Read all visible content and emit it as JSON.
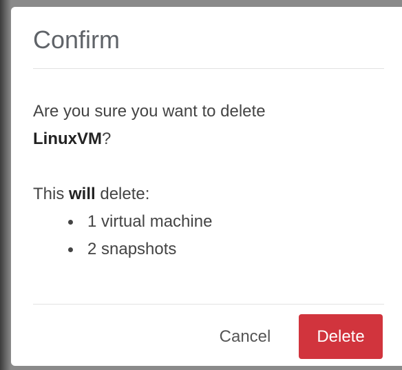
{
  "dialog": {
    "title": "Confirm",
    "question_prefix": "Are you sure you want to delete",
    "target_name": "LinuxVM",
    "question_suffix": "?",
    "will_prefix": "This ",
    "will_emphasis": "will",
    "will_suffix": " delete:",
    "items": [
      "1 virtual machine",
      "2 snapshots"
    ],
    "cancel_label": "Cancel",
    "delete_label": "Delete"
  },
  "colors": {
    "danger": "#d1343d",
    "title_text": "#5f6368",
    "body_text": "#444444"
  }
}
